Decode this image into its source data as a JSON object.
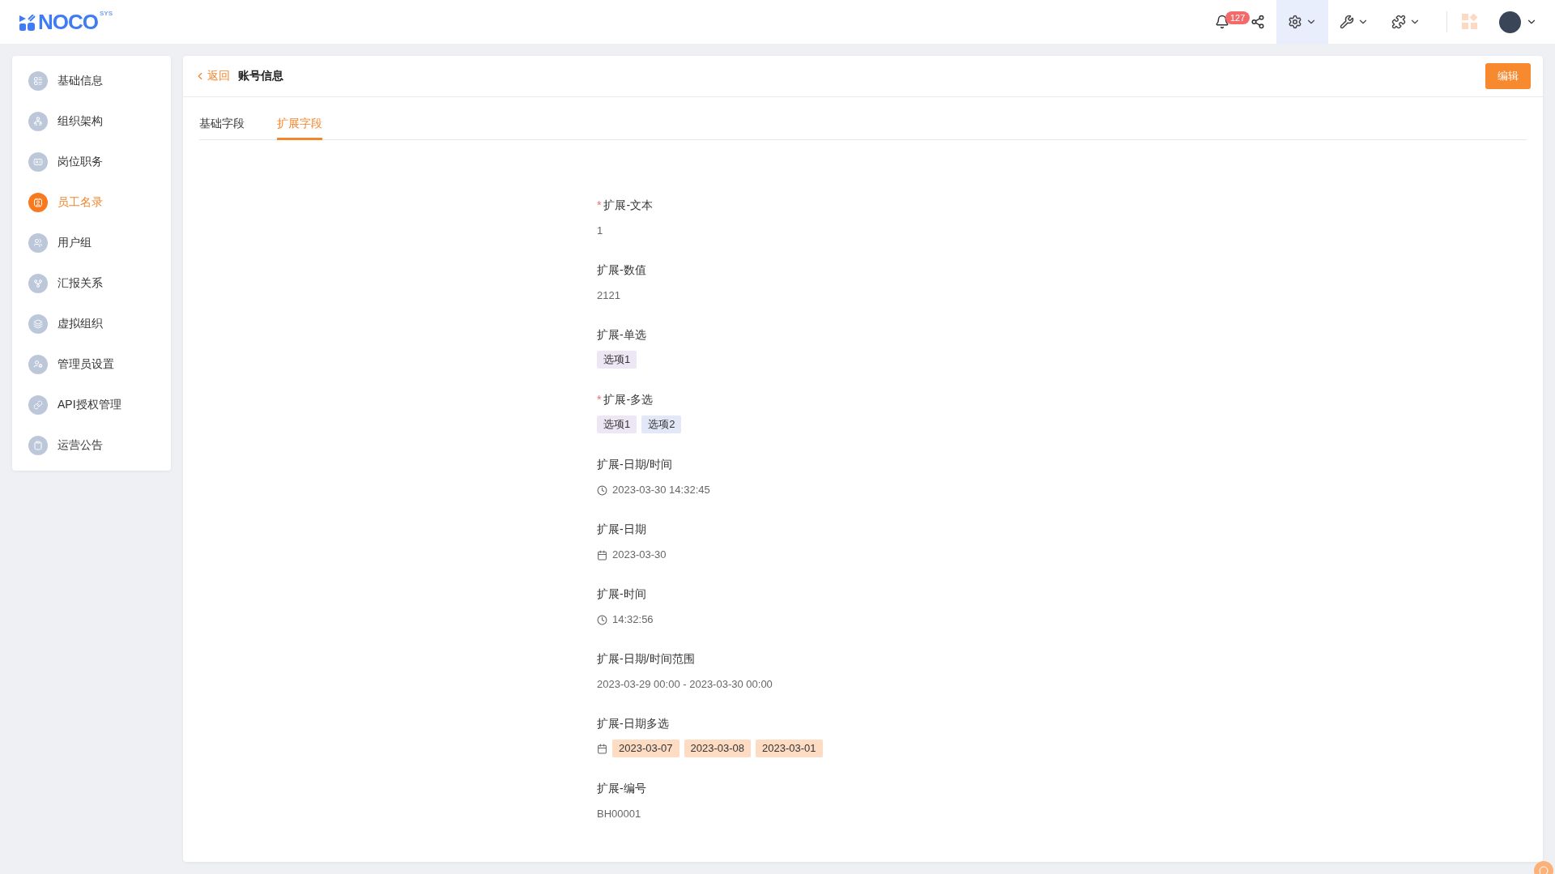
{
  "header": {
    "logo": "NOCO",
    "logo_sup": "SYS",
    "notification_count": "127",
    "tools": [
      {
        "kind": "settings",
        "selected": true
      },
      {
        "kind": "tools",
        "selected": false
      },
      {
        "kind": "plugins",
        "selected": false
      }
    ]
  },
  "sidebar": {
    "items": [
      {
        "label": "基础信息",
        "selected": false
      },
      {
        "label": "组织架构",
        "selected": false
      },
      {
        "label": "岗位职务",
        "selected": false
      },
      {
        "label": "员工名录",
        "selected": true
      },
      {
        "label": "用户组",
        "selected": false
      },
      {
        "label": "汇报关系",
        "selected": false
      },
      {
        "label": "虚拟组织",
        "selected": false
      },
      {
        "label": "管理员设置",
        "selected": false
      },
      {
        "label": "API授权管理",
        "selected": false
      },
      {
        "label": "运营公告",
        "selected": false
      }
    ]
  },
  "page": {
    "back": "返回",
    "title": "账号信息",
    "edit_button": "编辑"
  },
  "required_mark": "*",
  "tabs": [
    {
      "label": "基础字段",
      "selected": false
    },
    {
      "label": "扩展字段",
      "selected": true
    }
  ],
  "fields": [
    {
      "label": "扩展-文本",
      "required": true,
      "kind": "text",
      "value": "1"
    },
    {
      "label": "扩展-数值",
      "required": false,
      "kind": "text",
      "value": "2121"
    },
    {
      "label": "扩展-单选",
      "required": false,
      "kind": "tags",
      "tags": [
        {
          "text": "选项1",
          "color": "#ece6f5"
        }
      ]
    },
    {
      "label": "扩展-多选",
      "required": true,
      "kind": "tags",
      "tags": [
        {
          "text": "选项1",
          "color": "#ece6f5"
        },
        {
          "text": "选项2",
          "color": "#e3e8f8"
        }
      ]
    },
    {
      "label": "扩展-日期/时间",
      "required": false,
      "kind": "time",
      "value": "2023-03-30 14:32:45"
    },
    {
      "label": "扩展-日期",
      "required": false,
      "kind": "date",
      "value": "2023-03-30"
    },
    {
      "label": "扩展-时间",
      "required": false,
      "kind": "time",
      "value": "14:32:56"
    },
    {
      "label": "扩展-日期/时间范围",
      "required": false,
      "kind": "text",
      "value": "2023-03-29 00:00 - 2023-03-30 00:00"
    },
    {
      "label": "扩展-日期多选",
      "required": false,
      "kind": "datetags",
      "tags": [
        {
          "text": "2023-03-07",
          "color": "#fddcc3"
        },
        {
          "text": "2023-03-08",
          "color": "#fddcc3"
        },
        {
          "text": "2023-03-01",
          "color": "#fddcc3"
        }
      ]
    },
    {
      "label": "扩展-编号",
      "required": false,
      "kind": "text",
      "value": "BH00001"
    }
  ]
}
